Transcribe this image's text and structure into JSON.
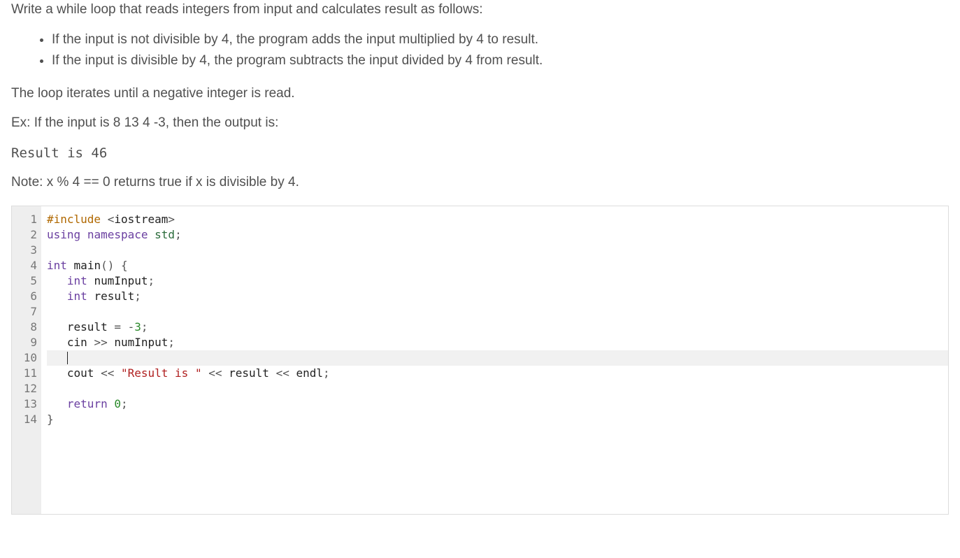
{
  "problem": {
    "intro": "Write a while loop that reads integers from input and calculates result as follows:",
    "bullets": [
      "If the input is not divisible by 4, the program adds the input multiplied by 4 to result.",
      "If the input is divisible by 4, the program subtracts the input divided by 4 from result."
    ],
    "loop_condition": "The loop iterates until a negative integer is read.",
    "example_intro": "Ex: If the input is 8 13 4 -3, then the output is:",
    "example_output": "Result is 46",
    "note": "Note: x % 4 == 0 returns true if x is divisible by 4."
  },
  "code": {
    "active_line": 10,
    "lines": [
      {
        "n": 1,
        "tokens": [
          [
            "preproc",
            "#include"
          ],
          [
            "plain",
            " "
          ],
          [
            "op",
            "<"
          ],
          [
            "ident",
            "iostream"
          ],
          [
            "op",
            ">"
          ]
        ]
      },
      {
        "n": 2,
        "tokens": [
          [
            "keyword",
            "using"
          ],
          [
            "plain",
            " "
          ],
          [
            "keyword",
            "namespace"
          ],
          [
            "plain",
            " "
          ],
          [
            "namespace",
            "std"
          ],
          [
            "punct",
            ";"
          ]
        ]
      },
      {
        "n": 3,
        "tokens": []
      },
      {
        "n": 4,
        "tokens": [
          [
            "type",
            "int"
          ],
          [
            "plain",
            " "
          ],
          [
            "ident",
            "main"
          ],
          [
            "punct",
            "()"
          ],
          [
            "plain",
            " "
          ],
          [
            "brace",
            "{"
          ]
        ]
      },
      {
        "n": 5,
        "tokens": [
          [
            "plain",
            "   "
          ],
          [
            "type",
            "int"
          ],
          [
            "plain",
            " "
          ],
          [
            "ident",
            "numInput"
          ],
          [
            "punct",
            ";"
          ]
        ]
      },
      {
        "n": 6,
        "tokens": [
          [
            "plain",
            "   "
          ],
          [
            "type",
            "int"
          ],
          [
            "plain",
            " "
          ],
          [
            "ident",
            "result"
          ],
          [
            "punct",
            ";"
          ]
        ]
      },
      {
        "n": 7,
        "tokens": []
      },
      {
        "n": 8,
        "tokens": [
          [
            "plain",
            "   "
          ],
          [
            "ident",
            "result"
          ],
          [
            "plain",
            " "
          ],
          [
            "op",
            "="
          ],
          [
            "plain",
            " "
          ],
          [
            "op",
            "-"
          ],
          [
            "number",
            "3"
          ],
          [
            "punct",
            ";"
          ]
        ]
      },
      {
        "n": 9,
        "tokens": [
          [
            "plain",
            "   "
          ],
          [
            "ident",
            "cin"
          ],
          [
            "plain",
            " "
          ],
          [
            "op",
            ">>"
          ],
          [
            "plain",
            " "
          ],
          [
            "ident",
            "numInput"
          ],
          [
            "punct",
            ";"
          ]
        ]
      },
      {
        "n": 10,
        "tokens": [
          [
            "plain",
            "   "
          ]
        ]
      },
      {
        "n": 11,
        "tokens": [
          [
            "plain",
            "   "
          ],
          [
            "ident",
            "cout"
          ],
          [
            "plain",
            " "
          ],
          [
            "op",
            "<<"
          ],
          [
            "plain",
            " "
          ],
          [
            "string",
            "\"Result is \""
          ],
          [
            "plain",
            " "
          ],
          [
            "op",
            "<<"
          ],
          [
            "plain",
            " "
          ],
          [
            "ident",
            "result"
          ],
          [
            "plain",
            " "
          ],
          [
            "op",
            "<<"
          ],
          [
            "plain",
            " "
          ],
          [
            "ident",
            "endl"
          ],
          [
            "punct",
            ";"
          ]
        ]
      },
      {
        "n": 12,
        "tokens": []
      },
      {
        "n": 13,
        "tokens": [
          [
            "plain",
            "   "
          ],
          [
            "keyword",
            "return"
          ],
          [
            "plain",
            " "
          ],
          [
            "number",
            "0"
          ],
          [
            "punct",
            ";"
          ]
        ]
      },
      {
        "n": 14,
        "tokens": [
          [
            "brace",
            "}"
          ]
        ]
      }
    ]
  }
}
